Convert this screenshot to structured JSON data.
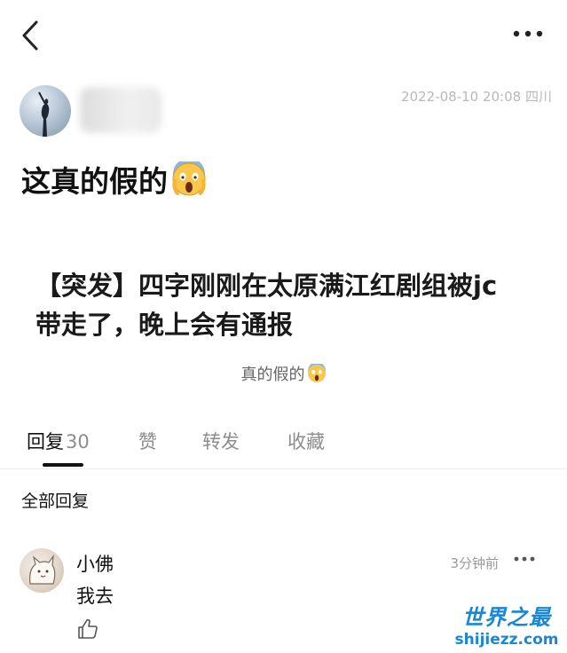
{
  "post": {
    "timestamp": "2022-08-10 20:08",
    "location": "四川",
    "title": "这真的假的",
    "body_line1": "【突发】四字刚刚在太原满江红剧组被jc",
    "body_line2": "带走了，晚上会有通报",
    "caption": "真的假的"
  },
  "tabs": [
    {
      "label": "回复",
      "count": "30"
    },
    {
      "label": "赞"
    },
    {
      "label": "转发"
    },
    {
      "label": "收藏"
    }
  ],
  "section_label": "全部回复",
  "comments": [
    {
      "user": "小佛",
      "time": "3分钟前",
      "text": "我去"
    }
  ],
  "watermark": {
    "title": "世界之最",
    "url": "shijiezz.com"
  },
  "icons": {
    "back": "chevron-left-icon",
    "more": "more-horizontal-icon",
    "emoji": "face-screaming-emoji",
    "like": "thumbs-up-icon"
  },
  "colors": {
    "accent_watermark": "#1a86d8",
    "meta_gray": "#b8b8b8",
    "tab_gray": "#8c8c8c"
  }
}
